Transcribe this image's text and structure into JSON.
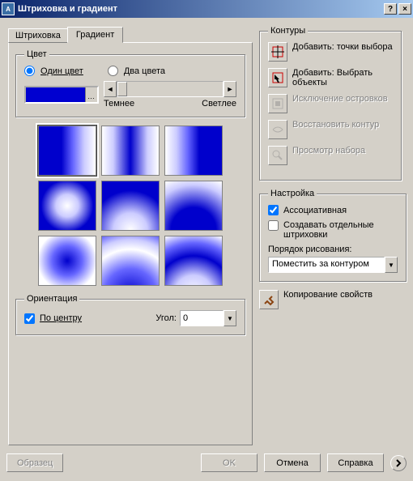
{
  "window": {
    "title": "Штриховка и градиент",
    "help": "?",
    "close": "×"
  },
  "tabs": {
    "hatch": "Штриховка",
    "gradient": "Градиент"
  },
  "color": {
    "legend": "Цвет",
    "one": "Один цвет",
    "two": "Два цвета",
    "darker": "Темнее",
    "lighter": "Светлее"
  },
  "orient": {
    "legend": "Ориентация",
    "center": "По центру",
    "angle_label": "Угол:",
    "angle_val": "0"
  },
  "contours": {
    "legend": "Контуры",
    "add_pick": "Добавить: точки выбора",
    "add_select": "Добавить: Выбрать объекты",
    "exclude": "Исключение островков",
    "restore": "Восстановить контур",
    "view": "Просмотр набора"
  },
  "settings": {
    "legend": "Настройка",
    "assoc": "Ассоциативная",
    "create_sep": "Создавать отдельные штриховки",
    "draw_order_label": "Порядок рисования:",
    "draw_order_val": "Поместить за контуром"
  },
  "copy_props": "Копирование свойств",
  "footer": {
    "sample": "Образец",
    "ok": "OK",
    "cancel": "Отмена",
    "help": "Справка"
  }
}
